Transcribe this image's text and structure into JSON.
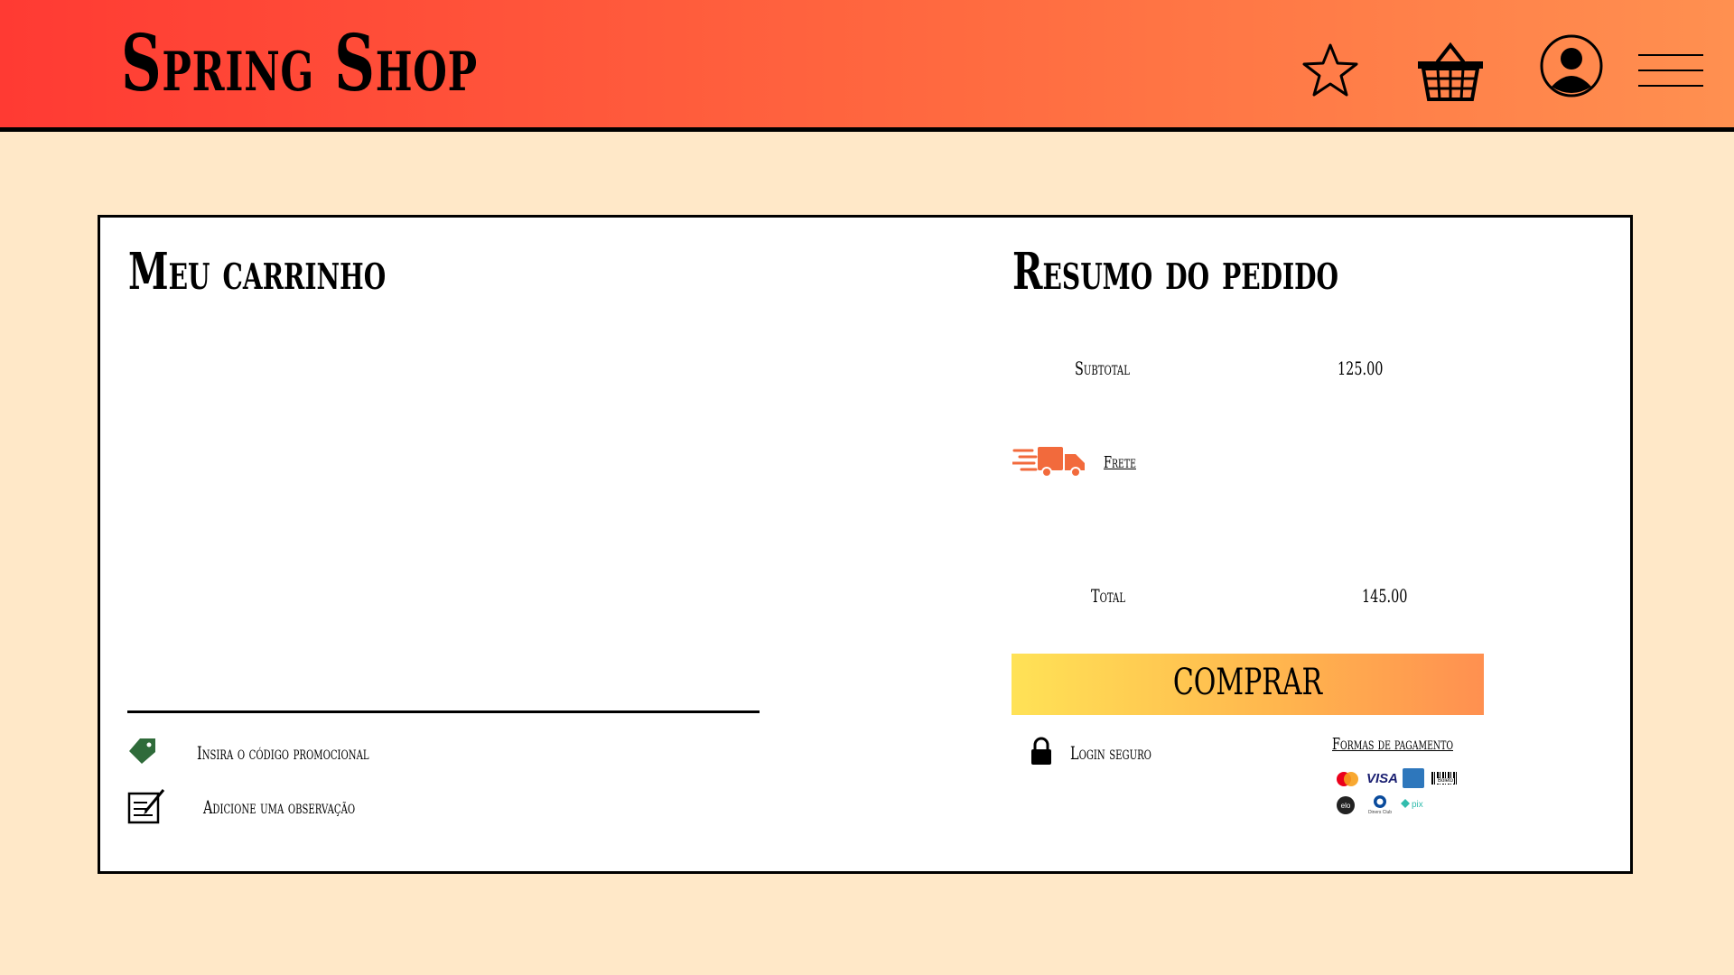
{
  "header": {
    "brand": "Spring Shop",
    "icons": [
      "star-icon",
      "basket-icon",
      "user-icon",
      "menu-icon"
    ]
  },
  "cart": {
    "title": "Meu carrinho",
    "promo_label": "Insira o código promocional",
    "note_label": "Adicione uma observação"
  },
  "summary": {
    "title": "Resumo do pedido",
    "subtotal_label": "Subtotal",
    "subtotal_value": "125.00",
    "shipping_label": "Frete",
    "total_label": "Total",
    "total_value": "145.00",
    "buy_label": "COMPRAR",
    "secure_label": "Login seguro",
    "payment_label": "Formas de pagamento",
    "payment_methods": [
      "mastercard",
      "visa",
      "amex",
      "boleto",
      "elo",
      "diners",
      "pix"
    ],
    "payment_method_text": {
      "visa": "VISA",
      "boleto": "Boleto",
      "elo": "elo",
      "diners": "Diners Club",
      "pix": "pix"
    }
  },
  "colors": {
    "header_start": "#FF3A33",
    "header_end": "#FF9050",
    "page_bg": "#FFE8C8",
    "button_start": "#FFE256",
    "button_end": "#FF9050",
    "truck": "#F26A3C",
    "tag": "#2F6B3A"
  }
}
